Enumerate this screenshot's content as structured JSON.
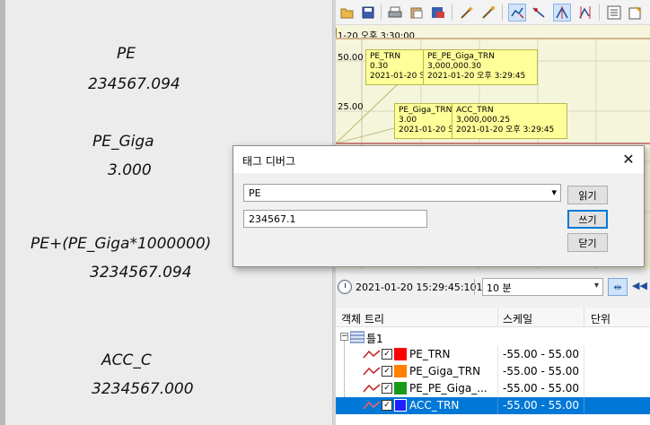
{
  "left_panel": {
    "tags": [
      {
        "name": "PE",
        "value": "234567.094"
      },
      {
        "name": "PE_Giga",
        "value": "3.000"
      },
      {
        "name": "PE+(PE_Giga*1000000)",
        "value": "3234567.094"
      },
      {
        "name": "ACC_C",
        "value": "3234567.000"
      }
    ]
  },
  "trend": {
    "header_time": "1-20 오후 3:30:00",
    "y_ticks": [
      "50.00",
      "25.00"
    ],
    "tooltips": [
      {
        "name": "PE_TRN",
        "value": "0.30",
        "time": "2021-01-20 오"
      },
      {
        "name": "PE_PE_Giga_TRN",
        "value": "3,000,000.30",
        "time": "2021-01-20 오후 3:29:45"
      },
      {
        "name": "PE_Giga_TRN",
        "value": "3.00",
        "time": "2021-01-20 오"
      },
      {
        "name": "ACC_TRN",
        "value": "3,000,000.25",
        "time": "2021-01-20 오후 3:29:45"
      }
    ],
    "colors": {
      "background": "#f5f5dc",
      "tooltip": "#ffff99"
    }
  },
  "timebar": {
    "current_time": "2021-01-20 15:29:45:101",
    "range": "10 분"
  },
  "tree": {
    "headers": {
      "object": "객체 트리",
      "scale": "스케일",
      "unit": "단위"
    },
    "group": "틀1",
    "rows": [
      {
        "label": "PE_TRN",
        "scale": "-55.00 - 55.00",
        "color": "#ff0000",
        "checked": "✓",
        "selected": false
      },
      {
        "label": "PE_Giga_TRN",
        "scale": "-55.00 - 55.00",
        "color": "#ff8000",
        "checked": "✓",
        "selected": false
      },
      {
        "label": "PE_PE_Giga_...",
        "scale": "-55.00 - 55.00",
        "color": "#1a9a1a",
        "checked": "✓",
        "selected": false
      },
      {
        "label": "ACC_TRN",
        "scale": "-55.00 - 55.00",
        "color": "#2020ff",
        "checked": "✓",
        "selected": true
      }
    ]
  },
  "dialog": {
    "title": "태그 디버그",
    "tag_value": "PE",
    "input_value": "234567.1",
    "read_label": "읽기",
    "write_label": "쓰기",
    "close_label": "닫기",
    "close_glyph": "✕"
  },
  "icons": {
    "dropdown": "▾",
    "fit": "⇹",
    "rewind": "◀◀",
    "expand": "−"
  }
}
